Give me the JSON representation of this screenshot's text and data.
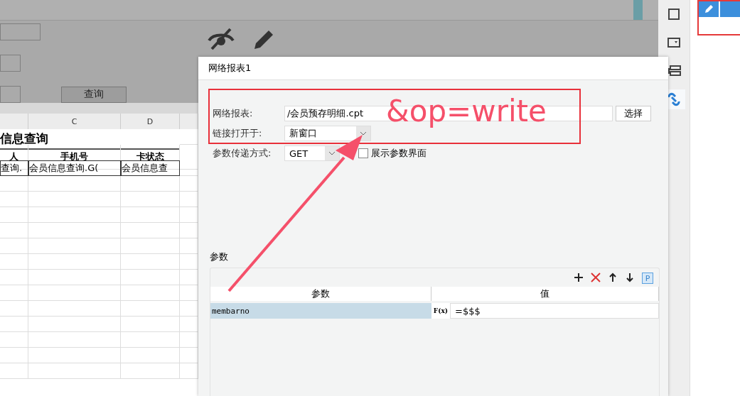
{
  "designer": {
    "search_button": "查询",
    "sheet": {
      "columns": [
        "",
        "C",
        "D"
      ],
      "title": "信息查询",
      "headers": [
        "人",
        "手机号",
        "卡状态"
      ],
      "rows": [
        [
          "查询.",
          "会员信息查询.G(",
          "会员信息查"
        ]
      ]
    }
  },
  "dialog": {
    "title": "网络报表1",
    "report_label": "网络报表:",
    "report_value": "/会员预存明细.cpt",
    "choose_button": "选择",
    "open_in_label": "链接打开于:",
    "open_in_value": "新窗口",
    "method_label": "参数传递方式:",
    "method_value": "GET",
    "show_params": {
      "label": "展示参数界面",
      "checked": false
    },
    "params": {
      "title": "参数",
      "param_button": "P",
      "columns": [
        "参数",
        "值"
      ],
      "rows": [
        {
          "name": "membarno",
          "formula_button": "F(x)",
          "value": "=$$$",
          "selected": true
        }
      ]
    }
  },
  "annotation": {
    "text": "&op=write"
  }
}
